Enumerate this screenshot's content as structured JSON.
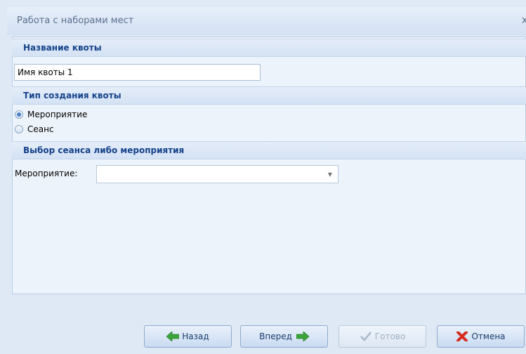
{
  "window": {
    "title": "Работа с наборами мест",
    "close": "x"
  },
  "sections": {
    "quota_name": "Название квоты",
    "creation_type": "Тип создания квоты",
    "selection": "Выбор сеанса либо мероприятия"
  },
  "quota_name_input": {
    "value": "Имя квоты 1"
  },
  "radios": [
    {
      "label": "Мероприятие",
      "checked": true
    },
    {
      "label": "Сеанс",
      "checked": false
    }
  ],
  "event_field": {
    "label": "Мероприятие:",
    "value": ""
  },
  "buttons": {
    "back": "Назад",
    "next": "Вперед",
    "done": "Готово",
    "cancel": "Отмена"
  },
  "colors": {
    "header_text": "#15428b",
    "panel_bg": "#edf3fb",
    "accent_green": "#3aa53a",
    "cancel_red": "#d62b1e"
  },
  "icons": {
    "back": "arrow-left-icon",
    "next": "arrow-right-icon",
    "done": "checkmark-icon",
    "cancel": "red-x-icon",
    "combo": "chevron-down-icon"
  }
}
